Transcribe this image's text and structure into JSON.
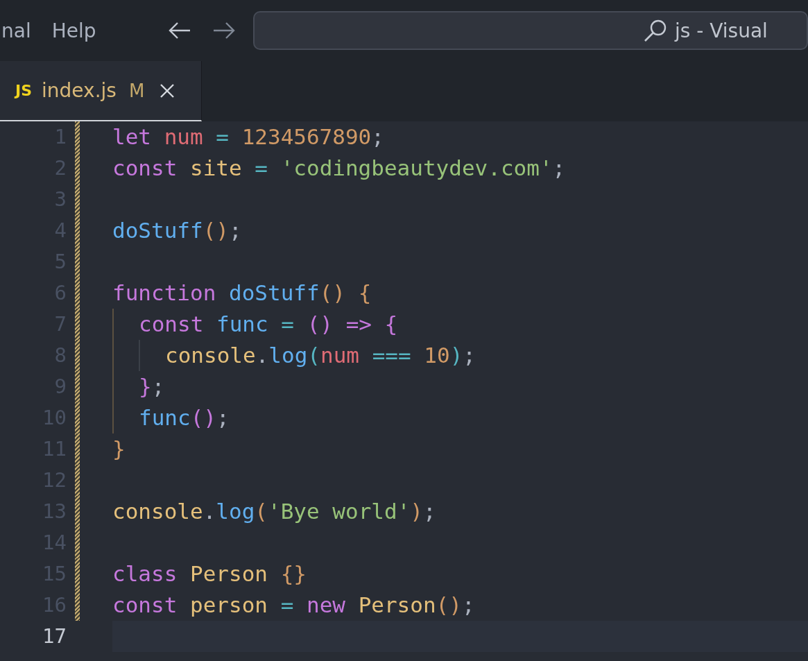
{
  "menu_bar": {
    "items": [
      "nal",
      "Help"
    ]
  },
  "command_center": {
    "text": "js - Visual"
  },
  "tabs": [
    {
      "icon_text": "JS",
      "label": "index.js",
      "status": "M",
      "selected": true,
      "modified": true
    }
  ],
  "editor": {
    "lines": [
      {
        "number": "1",
        "current": false,
        "modified": true,
        "tokens": [
          {
            "text": "let ",
            "color": "#c678dd"
          },
          {
            "text": "num ",
            "color": "#e06c75"
          },
          {
            "text": "= ",
            "color": "#56b6c2"
          },
          {
            "text": "1234567890",
            "color": "#d19a66"
          },
          {
            "text": ";",
            "color": "#abb2bf"
          }
        ]
      },
      {
        "number": "2",
        "current": false,
        "modified": true,
        "tokens": [
          {
            "text": "const ",
            "color": "#c678dd"
          },
          {
            "text": "site ",
            "color": "#e5c07b"
          },
          {
            "text": "= ",
            "color": "#56b6c2"
          },
          {
            "text": "'codingbeautydev.com'",
            "color": "#98c379"
          },
          {
            "text": ";",
            "color": "#abb2bf"
          }
        ]
      },
      {
        "number": "3",
        "current": false,
        "modified": true
      },
      {
        "number": "4",
        "current": false,
        "modified": true,
        "tokens": [
          {
            "text": "doStuff",
            "color": "#61afef"
          },
          {
            "text": "()",
            "color": "#d19a66"
          },
          {
            "text": ";",
            "color": "#abb2bf"
          }
        ]
      },
      {
        "number": "5",
        "current": false,
        "modified": true
      },
      {
        "number": "6",
        "current": false,
        "modified": true,
        "tokens": [
          {
            "text": "function ",
            "color": "#c678dd"
          },
          {
            "text": "doStuff",
            "color": "#61afef"
          },
          {
            "text": "() {",
            "color": "#d19a66"
          }
        ],
        "children": [
          {
            "number": "7",
            "current": false,
            "modified": true,
            "tokens": [
              {
                "text": "const ",
                "color": "#c678dd"
              },
              {
                "text": "func ",
                "color": "#61afef"
              },
              {
                "text": "= ",
                "color": "#56b6c2"
              },
              {
                "text": "() => {",
                "color": "#c678dd"
              }
            ],
            "children": [
              {
                "number": "8",
                "current": false,
                "modified": true,
                "tokens": [
                  {
                    "text": "console",
                    "color": "#e5c07b"
                  },
                  {
                    "text": ".",
                    "color": "#abb2bf"
                  },
                  {
                    "text": "log",
                    "color": "#61afef"
                  },
                  {
                    "text": "(",
                    "color": "#56b6c2"
                  },
                  {
                    "text": "num ",
                    "color": "#e06c75"
                  },
                  {
                    "text": "=== ",
                    "color": "#56b6c2"
                  },
                  {
                    "text": "10",
                    "color": "#d19a66"
                  },
                  {
                    "text": ")",
                    "color": "#56b6c2"
                  },
                  {
                    "text": ";",
                    "color": "#abb2bf"
                  }
                ]
              }
            ]
          },
          {
            "number": "9",
            "current": false,
            "modified": true,
            "tokens": [
              {
                "text": "}",
                "color": "#c678dd"
              },
              {
                "text": ";",
                "color": "#abb2bf"
              }
            ]
          },
          {
            "number": "10",
            "current": false,
            "modified": true,
            "tokens": [
              {
                "text": "func",
                "color": "#61afef"
              },
              {
                "text": "()",
                "color": "#c678dd"
              },
              {
                "text": ";",
                "color": "#abb2bf"
              }
            ]
          }
        ]
      },
      {
        "number": "11",
        "current": false,
        "modified": true,
        "tokens": [
          {
            "text": "}",
            "color": "#d19a66"
          }
        ]
      },
      {
        "number": "12",
        "current": false,
        "modified": true
      },
      {
        "number": "13",
        "current": false,
        "modified": true,
        "tokens": [
          {
            "text": "console",
            "color": "#e5c07b"
          },
          {
            "text": ".",
            "color": "#abb2bf"
          },
          {
            "text": "log",
            "color": "#61afef"
          },
          {
            "text": "(",
            "color": "#d19a66"
          },
          {
            "text": "'Bye world'",
            "color": "#98c379"
          },
          {
            "text": ")",
            "color": "#d19a66"
          },
          {
            "text": ";",
            "color": "#abb2bf"
          }
        ]
      },
      {
        "number": "14",
        "current": false,
        "modified": true
      },
      {
        "number": "15",
        "current": false,
        "modified": true,
        "tokens": [
          {
            "text": "class ",
            "color": "#c678dd"
          },
          {
            "text": "Person ",
            "color": "#e5c07b"
          },
          {
            "text": "{}",
            "color": "#d19a66"
          }
        ]
      },
      {
        "number": "16",
        "current": false,
        "modified": true,
        "tokens": [
          {
            "text": "const ",
            "color": "#c678dd"
          },
          {
            "text": "person ",
            "color": "#e5c07b"
          },
          {
            "text": "= ",
            "color": "#56b6c2"
          },
          {
            "text": "new ",
            "color": "#c678dd"
          },
          {
            "text": "Person",
            "color": "#e5c07b"
          },
          {
            "text": "()",
            "color": "#d19a66"
          },
          {
            "text": ";",
            "color": "#abb2bf"
          }
        ]
      },
      {
        "number": "17",
        "current": true,
        "modified": false
      }
    ]
  }
}
